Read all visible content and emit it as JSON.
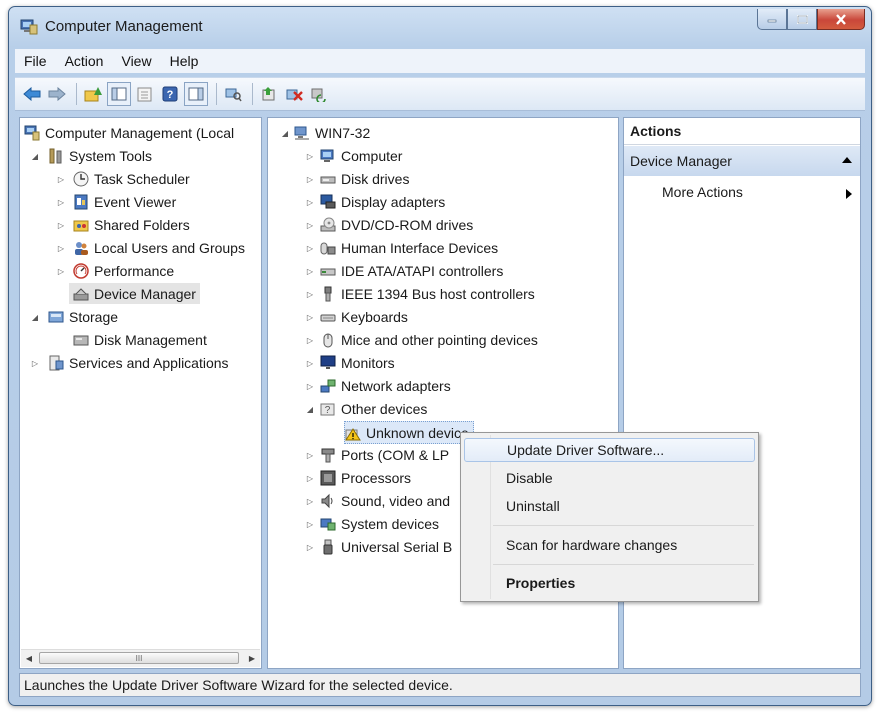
{
  "window": {
    "title": "Computer Management"
  },
  "menubar": {
    "items": [
      "File",
      "Action",
      "View",
      "Help"
    ]
  },
  "left_tree": {
    "nodes": [
      {
        "label": "Computer Management (Local",
        "icon": "computer-management-icon"
      },
      {
        "label": "System Tools",
        "icon": "tools-icon"
      },
      {
        "label": "Task Scheduler",
        "icon": "clock-icon"
      },
      {
        "label": "Event Viewer",
        "icon": "event-viewer-icon"
      },
      {
        "label": "Shared Folders",
        "icon": "shared-folder-icon"
      },
      {
        "label": "Local Users and Groups",
        "icon": "users-icon"
      },
      {
        "label": "Performance",
        "icon": "performance-icon"
      },
      {
        "label": "Device Manager",
        "icon": "device-manager-icon"
      },
      {
        "label": "Storage",
        "icon": "storage-icon"
      },
      {
        "label": "Disk Management",
        "icon": "disk-icon"
      },
      {
        "label": "Services and Applications",
        "icon": "services-icon"
      }
    ],
    "scroll_thumb_glyph": "III"
  },
  "device_tree": {
    "root": "WIN7-32",
    "categories": [
      {
        "label": "Computer",
        "icon": "computer-icon"
      },
      {
        "label": "Disk drives",
        "icon": "disk-drive-icon"
      },
      {
        "label": "Display adapters",
        "icon": "display-adapter-icon"
      },
      {
        "label": "DVD/CD-ROM drives",
        "icon": "dvd-icon"
      },
      {
        "label": "Human Interface Devices",
        "icon": "hid-icon"
      },
      {
        "label": "IDE ATA/ATAPI controllers",
        "icon": "ide-icon"
      },
      {
        "label": "IEEE 1394 Bus host controllers",
        "icon": "firewire-icon"
      },
      {
        "label": "Keyboards",
        "icon": "keyboard-icon"
      },
      {
        "label": "Mice and other pointing devices",
        "icon": "mouse-icon"
      },
      {
        "label": "Monitors",
        "icon": "monitor-icon"
      },
      {
        "label": "Network adapters",
        "icon": "network-icon"
      },
      {
        "label": "Other devices",
        "icon": "other-devices-icon"
      },
      {
        "label": "Unknown device",
        "icon": "warning-device-icon"
      },
      {
        "label": "Ports (COM & LP",
        "icon": "port-icon"
      },
      {
        "label": "Processors",
        "icon": "processor-icon"
      },
      {
        "label": "Sound, video and",
        "icon": "sound-icon"
      },
      {
        "label": "System devices",
        "icon": "system-devices-icon"
      },
      {
        "label": "Universal Serial B",
        "icon": "usb-icon"
      }
    ]
  },
  "actions": {
    "header": "Actions",
    "section": "Device Manager",
    "more": "More Actions"
  },
  "context_menu": {
    "items": [
      "Update Driver Software...",
      "Disable",
      "Uninstall",
      "Scan for hardware changes",
      "Properties"
    ]
  },
  "status": {
    "text": "Launches the Update Driver Software Wizard for the selected device."
  },
  "colors": {
    "title_bar": "#c4d7ee",
    "selection": "#cde0f7",
    "accent": "#1f5fae"
  }
}
